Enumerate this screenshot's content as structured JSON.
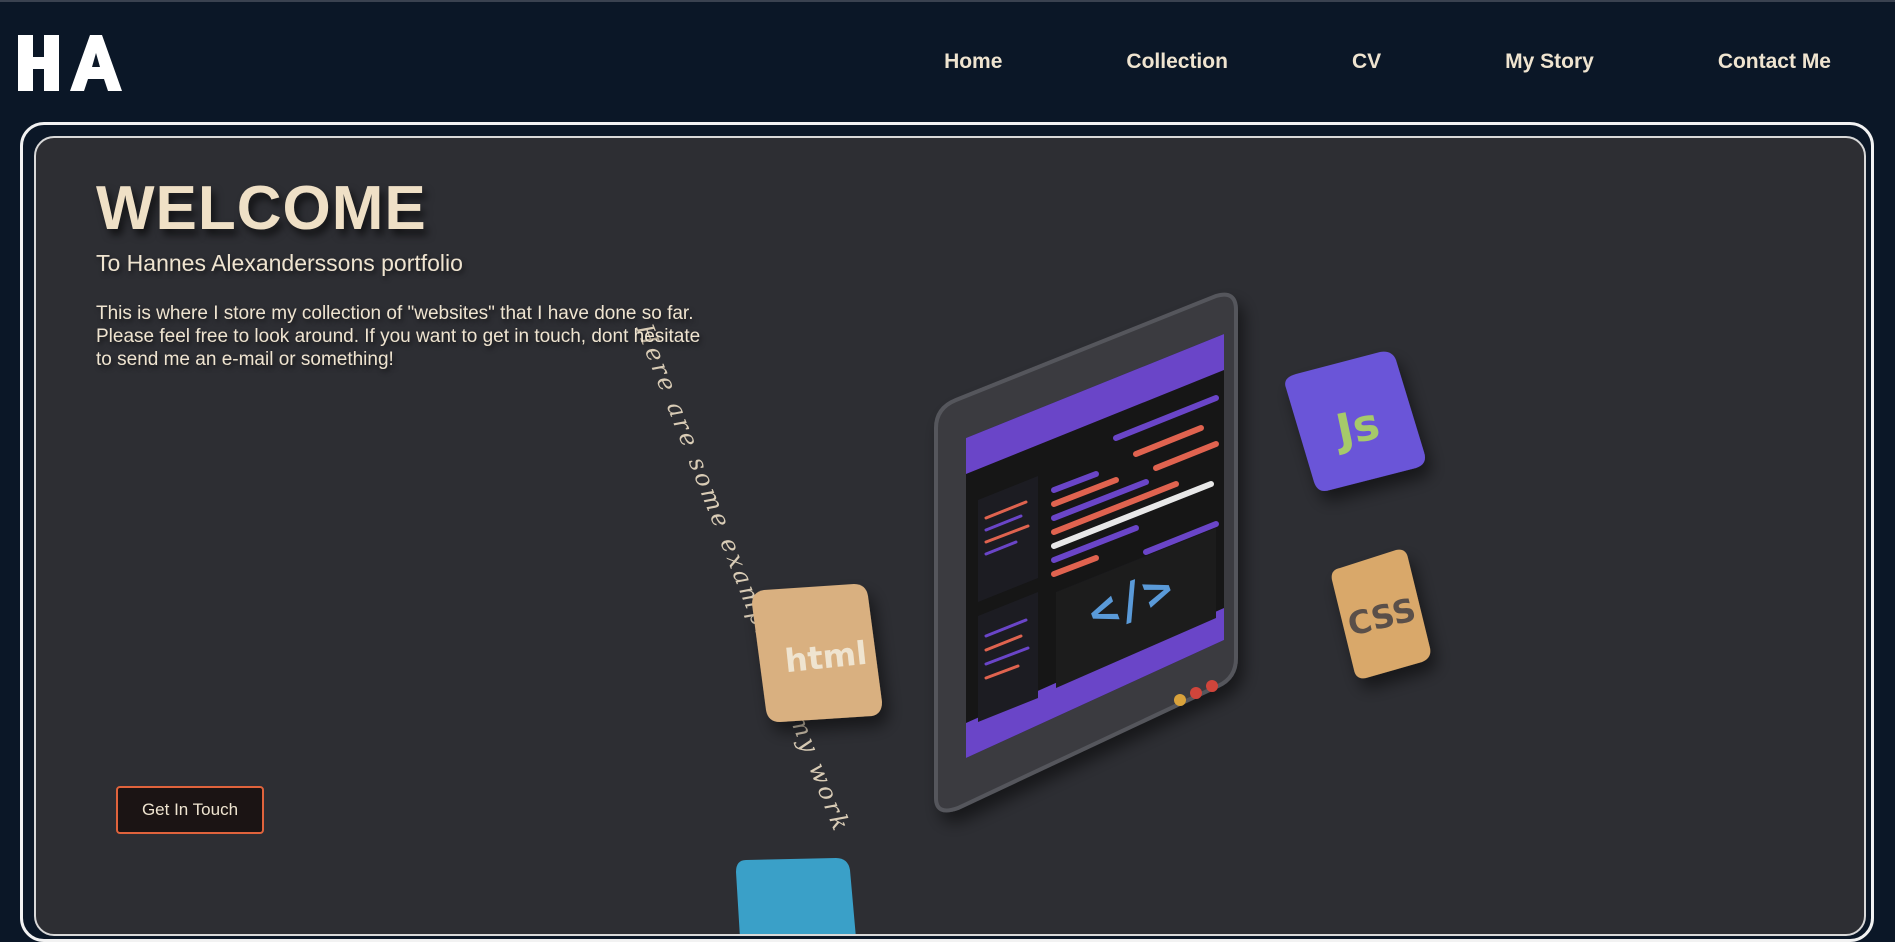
{
  "header": {
    "logo_text": "HA",
    "nav": [
      {
        "label": "Home"
      },
      {
        "label": "Collection"
      },
      {
        "label": "CV"
      },
      {
        "label": "My Story"
      },
      {
        "label": "Contact Me"
      }
    ]
  },
  "hero": {
    "title": "WELCOME",
    "subtitle": "To Hannes Alexanderssons portfolio",
    "intro": "This is where I store my collection of \"websites\" that I have done so far. Please feel free to look around. If you want to get in touch, dont hesitate to send me an e-mail or something!",
    "cta_label": "Get In Touch",
    "path_text": "Here are some examples of my work",
    "badges": {
      "js": "Js",
      "css": "CSS",
      "html": "html"
    }
  },
  "colors": {
    "background": "#0b1727",
    "panel": "#2d2e33",
    "accent_text": "#efe0c6",
    "cta_border": "#e0633c",
    "purple": "#6a45c8",
    "tan": "#d9a86a",
    "teal": "#3aa0c8"
  }
}
